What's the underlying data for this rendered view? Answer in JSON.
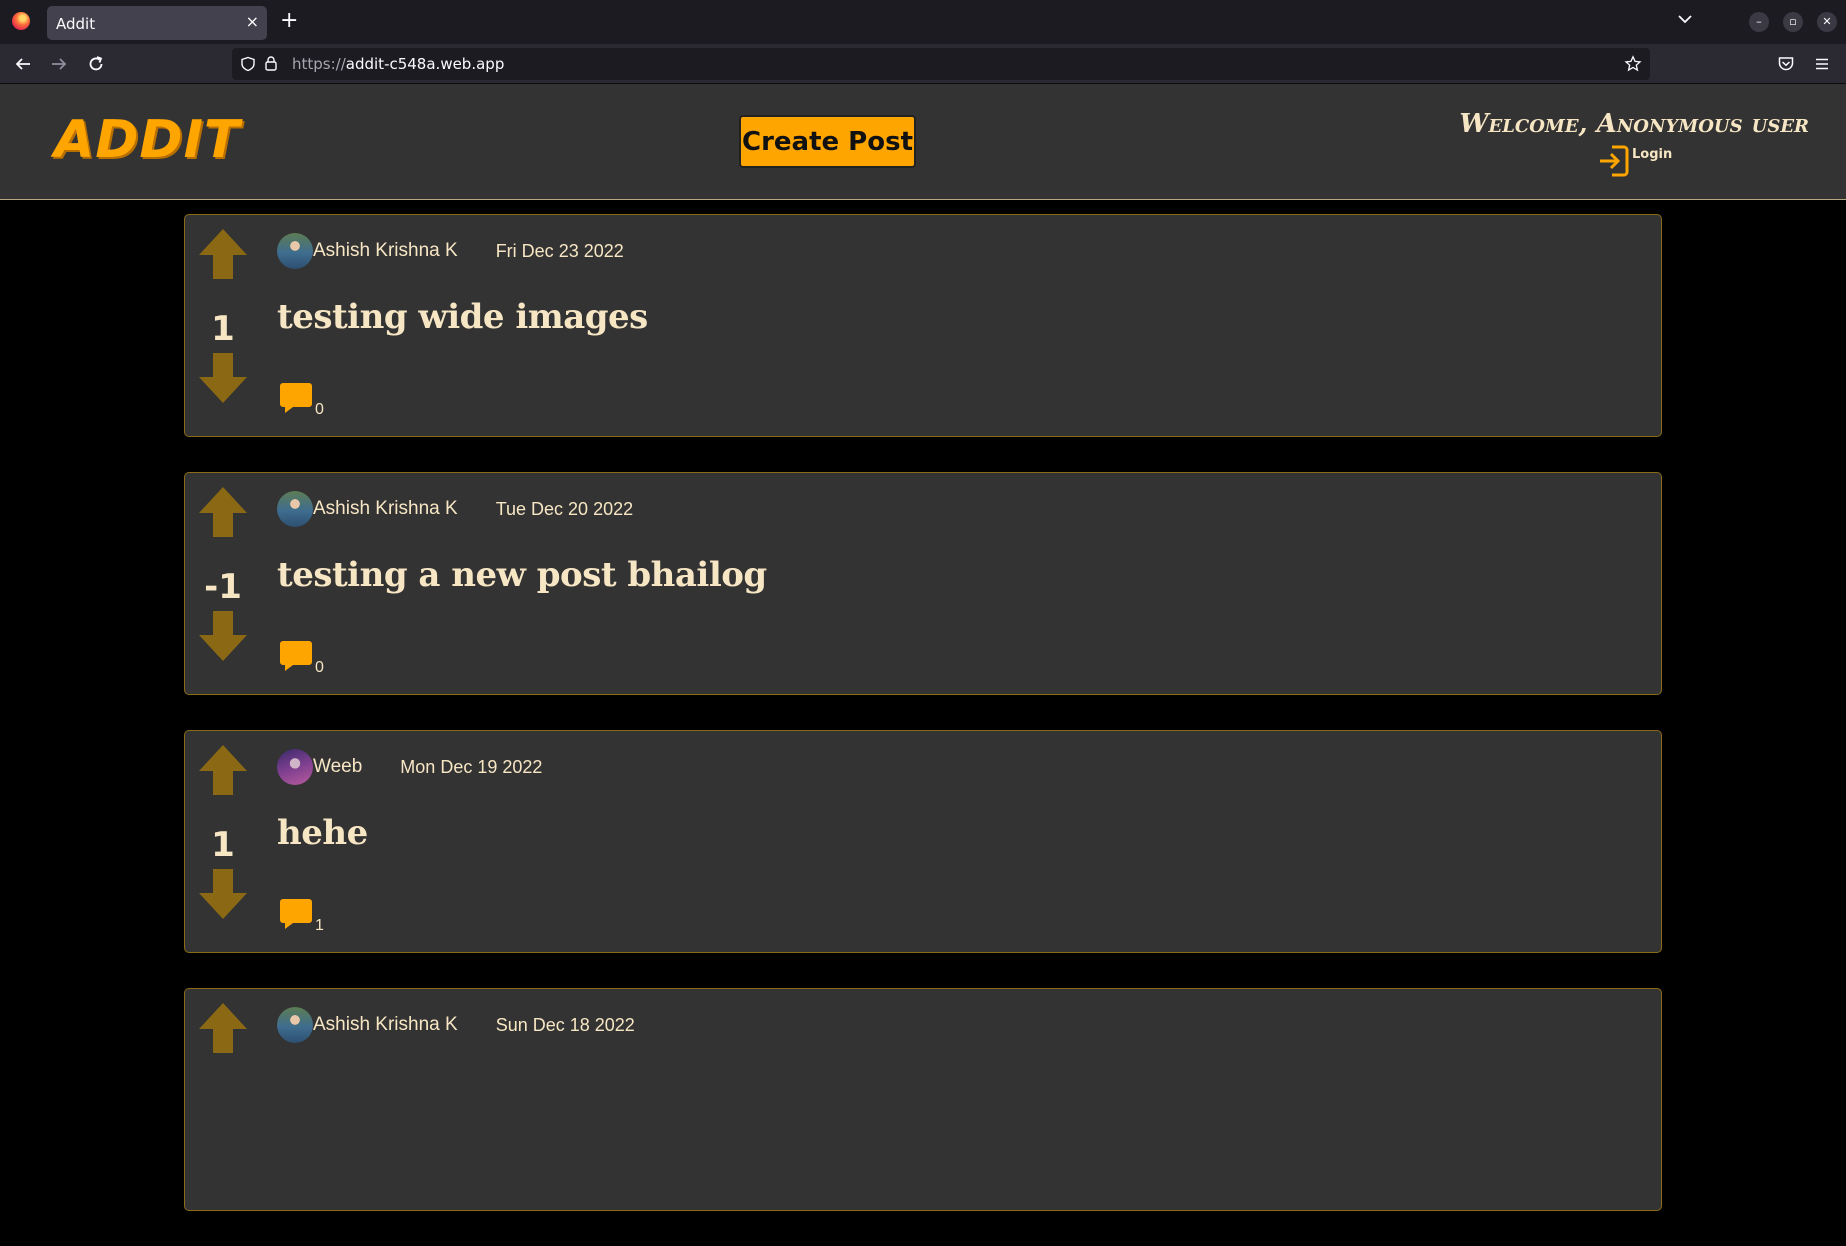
{
  "browser": {
    "tab_title": "Addit",
    "tab_close": "×",
    "new_tab": "+",
    "url_scheme": "https://",
    "url_host": "addit-c548a.web.app"
  },
  "header": {
    "logo": "ADDIT",
    "create_post_label": "Create Post",
    "welcome_text": "Welcome, Anonymous user",
    "login_label": "Login",
    "accent_color": "#ffa500"
  },
  "posts": [
    {
      "author": "Ashish Krishna K",
      "date": "Fri Dec 23 2022",
      "title": "testing wide images",
      "score": "1",
      "comments": "0",
      "avatar": "ashish-avatar"
    },
    {
      "author": "Ashish Krishna K",
      "date": "Tue Dec 20 2022",
      "title": "testing a new post bhailog",
      "score": "-1",
      "comments": "0",
      "avatar": "ashish-avatar"
    },
    {
      "author": "Weeb",
      "date": "Mon Dec 19 2022",
      "title": "hehe",
      "score": "1",
      "comments": "1",
      "avatar": "weeb-avatar"
    },
    {
      "author": "Ashish Krishna K",
      "date": "Sun Dec 18 2022",
      "title": "",
      "score": "",
      "comments": "",
      "avatar": "ashish-avatar"
    }
  ],
  "icons": {
    "upvote": "arrow-up-icon",
    "downvote": "arrow-down-icon",
    "comment": "speech-bubble-icon",
    "login": "sign-in-icon"
  }
}
